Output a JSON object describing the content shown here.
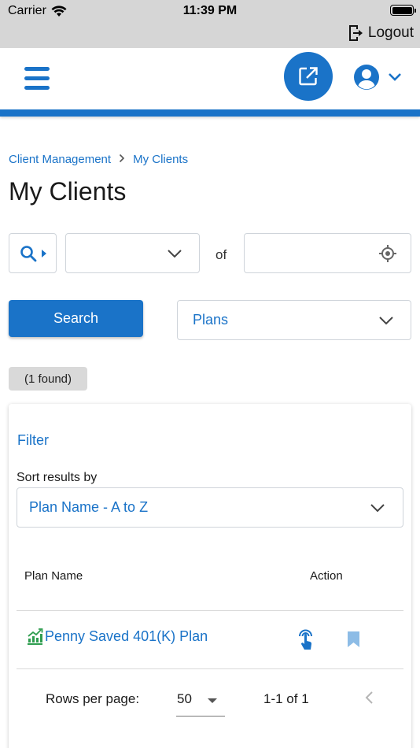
{
  "status_bar": {
    "carrier": "Carrier",
    "time": "11:39 PM"
  },
  "top_bar": {
    "logout_label": "Logout"
  },
  "header": {
    "menu_icon": "hamburger-icon",
    "external_icon": "external-link-icon",
    "profile_icon": "account-circle-icon",
    "accent_color": "#1a73c8"
  },
  "breadcrumb": [
    "Client Management",
    "My Clients"
  ],
  "page_title": "My Clients",
  "search_row": {
    "search_type_icon": "search-icon",
    "field_value": "",
    "of_label": "of",
    "location_value": ""
  },
  "search_button": "Search",
  "plans_select": {
    "value": "Plans"
  },
  "found_badge": "(1 found)",
  "results_card": {
    "filter_label": "Filter",
    "sort_label": "Sort results by",
    "sort_value": "Plan Name - A to Z",
    "columns": [
      "Plan Name",
      "Action"
    ],
    "rows": [
      {
        "plan_name": "Penny Saved 401(K) Plan",
        "plan_icon": "growth-chart-icon",
        "actions": [
          "touch-icon",
          "bookmark-icon"
        ]
      }
    ],
    "pagination": {
      "rows_per_page_label": "Rows per page:",
      "rows_per_page": "50",
      "range": "1-1 of 1"
    }
  }
}
